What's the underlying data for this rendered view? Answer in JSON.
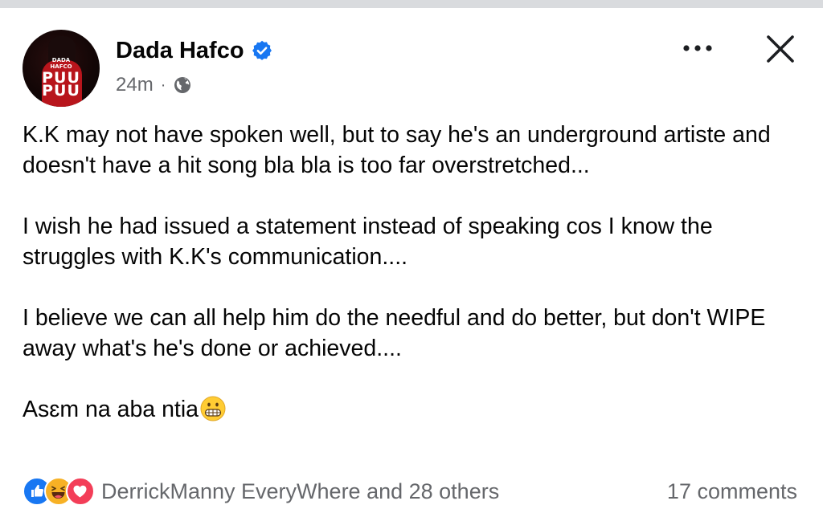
{
  "author": {
    "name": "Dada Hafco",
    "avatar_text_small_1": "DADA",
    "avatar_text_small_2": "HAFCO",
    "avatar_text_big_1": "PUU",
    "avatar_text_big_2": "PUU"
  },
  "meta": {
    "time": "24m",
    "separator": "·",
    "audience_icon": "globe-icon"
  },
  "header_actions": {
    "more_label": "•••",
    "close_icon": "close-icon"
  },
  "post": {
    "paragraphs": [
      "K.K may not have spoken well, but to say he's an underground artiste and doesn't have a hit song bla bla is too far overstretched...",
      "I wish he had issued a statement instead of speaking cos I know the struggles with K.K's communication....",
      "I believe we can all help him do the needful and do better, but don't WIPE away what's he's done or achieved....",
      "Asɛm na aba ntia"
    ],
    "final_emoji": "grimacing-face-emoji"
  },
  "footer": {
    "reaction_icons": [
      "like-icon",
      "haha-icon",
      "love-icon"
    ],
    "reacted_by": "DerrickManny EveryWhere and 28 others",
    "comments": "17 comments"
  },
  "colors": {
    "primary_text": "#050505",
    "secondary_text": "#65676b",
    "verified_blue": "#1877f2",
    "like_blue": "#1877f2",
    "love_red": "#f33e58",
    "haha_yellow": "#f7b125"
  }
}
